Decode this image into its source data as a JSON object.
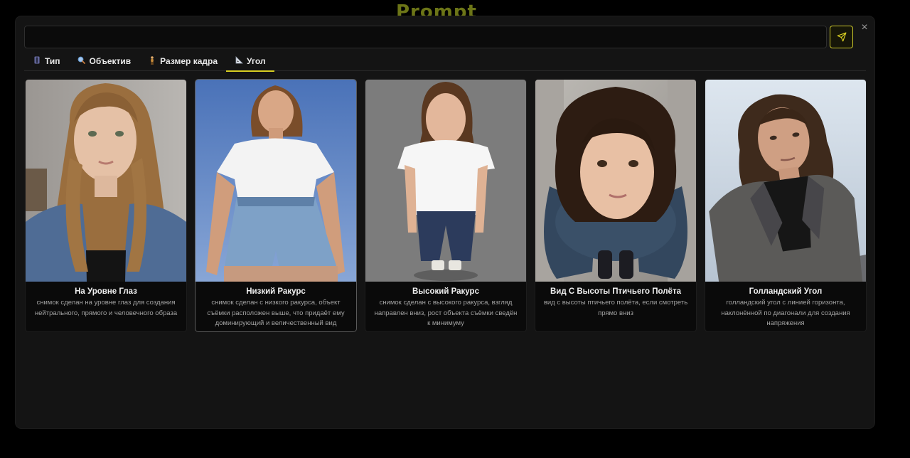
{
  "background_logo": "Prompt",
  "modal": {
    "close_icon": "×",
    "prompt_input": {
      "value": "",
      "placeholder": ""
    },
    "send_button_icon": "send-icon"
  },
  "tabs": [
    {
      "label": "Тип",
      "icon": "film-strip-icon",
      "active": false
    },
    {
      "label": "Объектив",
      "icon": "magnifier-icon",
      "active": false
    },
    {
      "label": "Размер кадра",
      "icon": "person-icon",
      "active": false
    },
    {
      "label": "Угол",
      "icon": "triangle-ruler-icon",
      "active": true
    }
  ],
  "cards": [
    {
      "title": "На Уровне Глаз",
      "description": "снимок сделан на уровне глаз для создания нейтрального, прямого и человечного образа",
      "selected": false
    },
    {
      "title": "Низкий Ракурс",
      "description": "снимок сделан с низкого ракурса, объект съёмки расположен выше, что придаёт ему доминирующий и величественный вид",
      "selected": true
    },
    {
      "title": "Высокий Ракурс",
      "description": "снимок сделан с высокого ракурса, взгляд направлен вниз, рост объекта съёмки сведён к минимуму",
      "selected": false
    },
    {
      "title": "Вид С Высоты Птичьего Полёта",
      "description": "вид с высоты птичьего полёта, если смотреть прямо вниз",
      "selected": false
    },
    {
      "title": "Голландский Угол",
      "description": "голландский угол с линией горизонта, наклонённой по диагонали для создания напряжения",
      "selected": false
    }
  ],
  "colors": {
    "accent": "#d8cf22",
    "modal_bg": "#141414",
    "page_bg": "#000000"
  }
}
